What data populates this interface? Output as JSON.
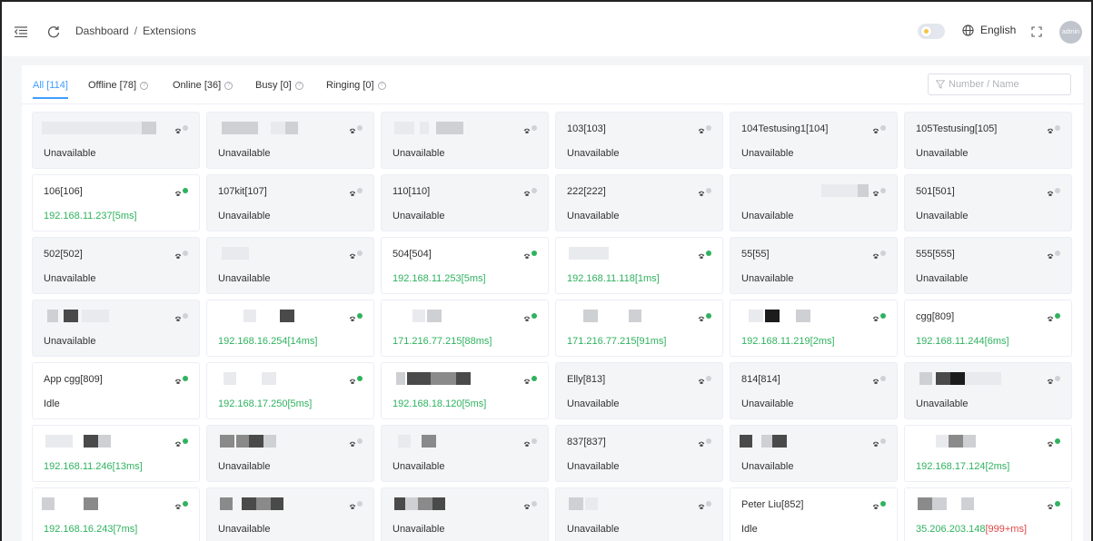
{
  "header": {
    "breadcrumb": [
      "Dashboard",
      "Extensions"
    ],
    "breadcrumb_sep": "/",
    "language": "English",
    "avatar": "admin"
  },
  "tabs": [
    {
      "label": "All [114]",
      "active": true,
      "help": false
    },
    {
      "label": "Offline [78]",
      "active": false,
      "help": true
    },
    {
      "label": "Online [36]",
      "active": false,
      "help": true
    },
    {
      "label": "Busy [0]",
      "active": false,
      "help": true
    },
    {
      "label": "Ringing [0]",
      "active": false,
      "help": true
    }
  ],
  "search": {
    "placeholder": "Number / Name"
  },
  "colors": {
    "online": "#2fb25f",
    "offline": "#cfd1d6",
    "accent": "#409eff",
    "warning": "#e04848"
  },
  "extensions": [
    {
      "name": "",
      "status": "Unavailable",
      "online": false
    },
    {
      "name": "",
      "status": "Unavailable",
      "online": false
    },
    {
      "name": "",
      "status": "Unavailable",
      "online": false
    },
    {
      "name": "103[103]",
      "status": "Unavailable",
      "online": false
    },
    {
      "name": "104Testusing1[104]",
      "status": "Unavailable",
      "online": false
    },
    {
      "name": "105Testusing[105]",
      "status": "Unavailable",
      "online": false
    },
    {
      "name": "106[106]",
      "status": "192.168.11.237[5ms]",
      "online": true
    },
    {
      "name": "107kit[107]",
      "status": "Unavailable",
      "online": false
    },
    {
      "name": "110[110]",
      "status": "Unavailable",
      "online": false
    },
    {
      "name": "222[222]",
      "status": "Unavailable",
      "online": false
    },
    {
      "name": "",
      "status": "Unavailable",
      "online": false
    },
    {
      "name": "501[501]",
      "status": "Unavailable",
      "online": false
    },
    {
      "name": "502[502]",
      "status": "Unavailable",
      "online": false
    },
    {
      "name": "",
      "status": "Unavailable",
      "online": false
    },
    {
      "name": "504[504]",
      "status": "192.168.11.253[5ms]",
      "online": true
    },
    {
      "name": "",
      "status": "192.168.11.118[1ms]",
      "online": true
    },
    {
      "name": "55[55]",
      "status": "Unavailable",
      "online": false
    },
    {
      "name": "555[555]",
      "status": "Unavailable",
      "online": false
    },
    {
      "name": "",
      "status": "Unavailable",
      "online": false
    },
    {
      "name": "",
      "status": "192.168.16.254[14ms]",
      "online": true
    },
    {
      "name": "",
      "status": "171.216.77.215[88ms]",
      "online": true
    },
    {
      "name": "",
      "status": "171.216.77.215[91ms]",
      "online": true
    },
    {
      "name": "",
      "status": "192.168.11.219[2ms]",
      "online": true
    },
    {
      "name": "cgg[809]",
      "status": "192.168.11.244[6ms]",
      "online": true
    },
    {
      "name": "App cgg[809]",
      "status": "Idle",
      "online": true
    },
    {
      "name": "",
      "status": "192.168.17.250[5ms]",
      "online": true
    },
    {
      "name": "",
      "status": "192.168.18.120[5ms]",
      "online": true
    },
    {
      "name": "Elly[813]",
      "status": "Unavailable",
      "online": false
    },
    {
      "name": "814[814]",
      "status": "Unavailable",
      "online": false
    },
    {
      "name": "",
      "status": "Unavailable",
      "online": false
    },
    {
      "name": "",
      "status": "192.168.11.246[13ms]",
      "online": true
    },
    {
      "name": "",
      "status": "Unavailable",
      "online": false
    },
    {
      "name": "",
      "status": "Unavailable",
      "online": false
    },
    {
      "name": "837[837]",
      "status": "Unavailable",
      "online": false
    },
    {
      "name": "",
      "status": "Unavailable",
      "online": false
    },
    {
      "name": "",
      "status": "192.168.17.124[2ms]",
      "online": true
    },
    {
      "name": "",
      "status": "192.168.16.243[7ms]",
      "online": true
    },
    {
      "name": "",
      "status": "Unavailable",
      "online": false
    },
    {
      "name": "",
      "status": "Unavailable",
      "online": false
    },
    {
      "name": "",
      "status": "Unavailable",
      "online": false
    },
    {
      "name": "Peter Liu[852]",
      "status": "Idle",
      "online": true
    },
    {
      "name": "",
      "status": "35.206.203.148",
      "status_extra": "[999+ms]",
      "online": true
    }
  ]
}
